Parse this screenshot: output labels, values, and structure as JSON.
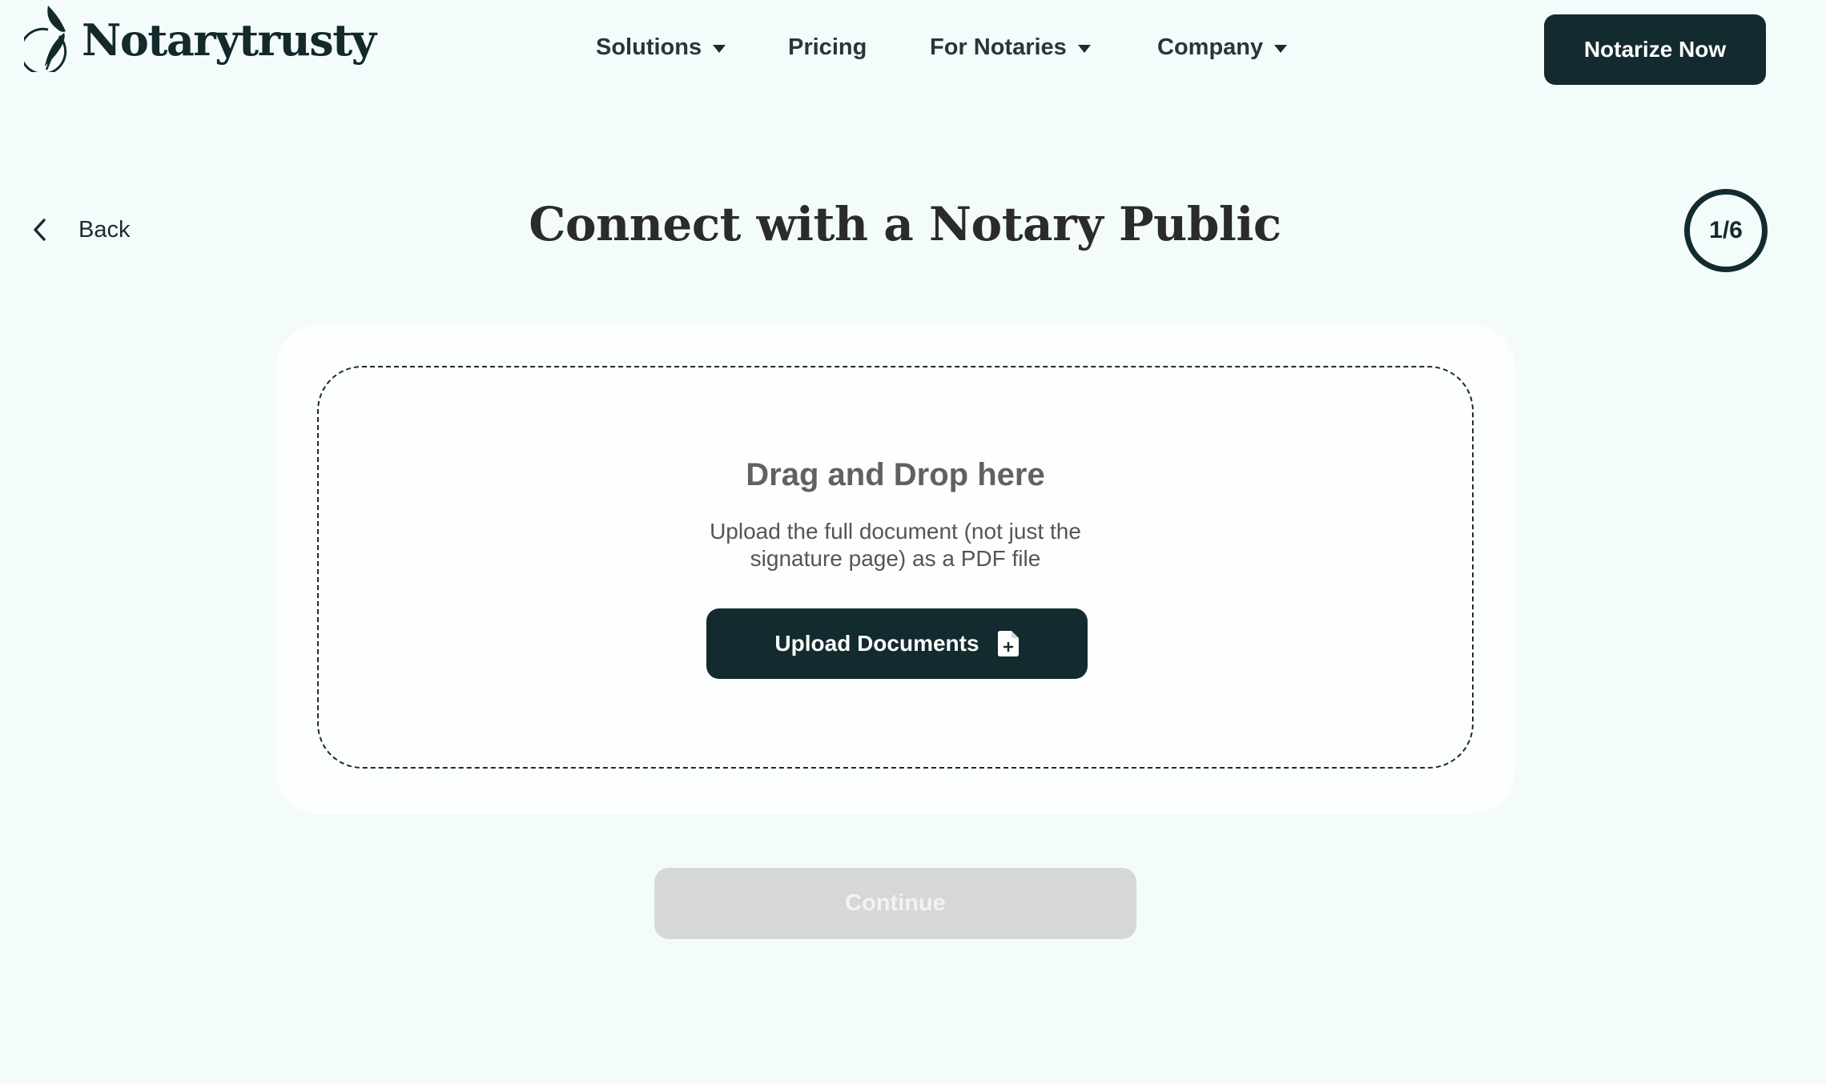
{
  "brand": {
    "name": "Notarytrusty",
    "icon": "quill-logo-icon",
    "primary_color": "#132b2e",
    "background_color": "#f4fbfb"
  },
  "nav": {
    "items": [
      {
        "label": "Solutions",
        "has_dropdown": true
      },
      {
        "label": "Pricing",
        "has_dropdown": false
      },
      {
        "label": "For Notaries",
        "has_dropdown": true
      },
      {
        "label": "Company",
        "has_dropdown": true
      }
    ],
    "cta_label": "Notarize Now"
  },
  "page": {
    "back_label": "Back",
    "title": "Connect with a Notary Public",
    "step_indicator": "1/6"
  },
  "upload": {
    "title": "Drag and Drop here",
    "description": "Upload the full document (not just the signature page) as a PDF file",
    "button_label": "Upload Documents",
    "button_icon": "file-plus-icon"
  },
  "footer": {
    "continue_label": "Continue",
    "continue_disabled": true
  }
}
